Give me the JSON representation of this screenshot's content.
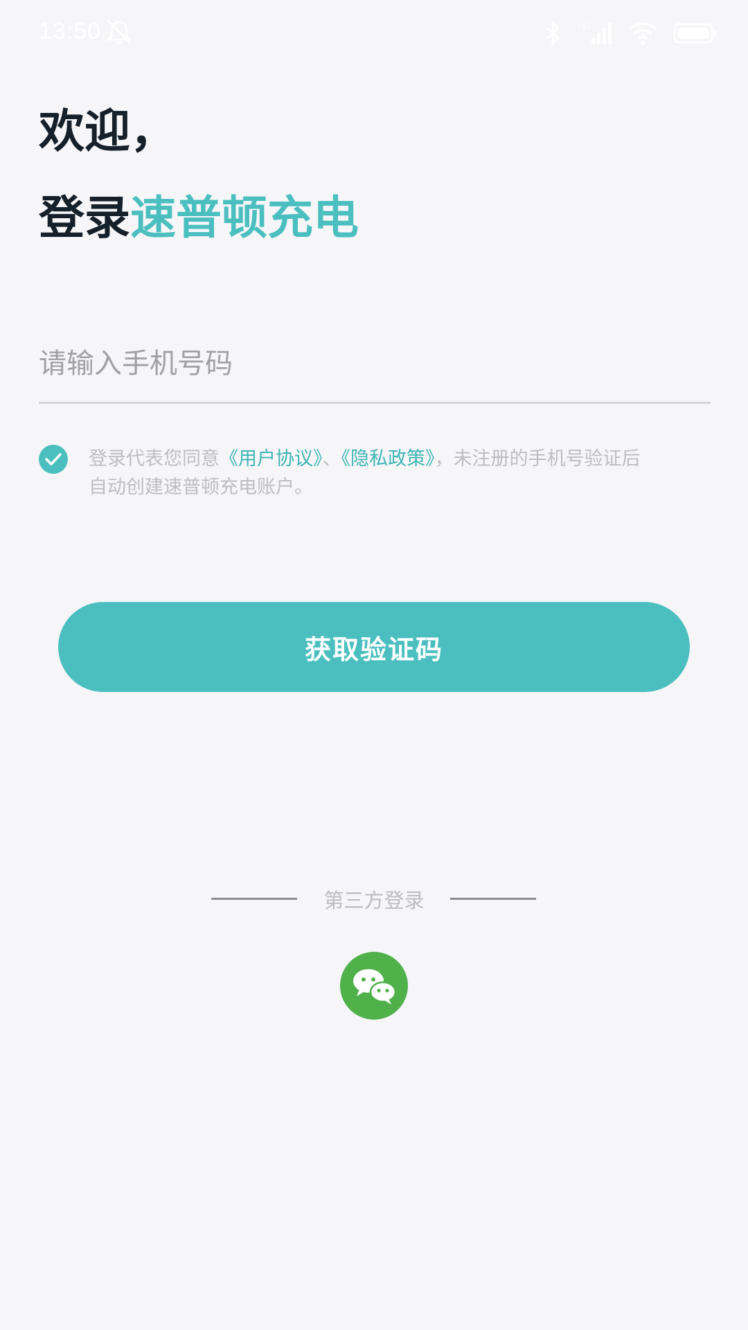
{
  "status_bar": {
    "time": "13:50",
    "mute_icon": "bell-off-icon",
    "bluetooth_icon": "bluetooth-icon",
    "signal_icon": "signal-icon",
    "wifi_icon": "wifi-icon",
    "battery_icon": "battery-icon"
  },
  "header": {
    "welcome": "欢迎，",
    "login_prefix": "登录",
    "brand_name": "速普顿充电"
  },
  "phone_input": {
    "placeholder": "请输入手机号码",
    "value": ""
  },
  "agreement": {
    "checked": true,
    "text_before": "登录代表您同意",
    "user_agreement": "《用户协议》",
    "separator": "、",
    "privacy_policy": "《隐私政策》",
    "text_after": "，未注册的手机号验证后",
    "line2": "自动创建速普顿充电账户。"
  },
  "primary_button": {
    "label": "获取验证码"
  },
  "third_party": {
    "label": "第三方登录",
    "wechat_icon": "wechat-icon"
  },
  "colors": {
    "accent": "#4bbfbf",
    "background": "#f6f6f9",
    "heading": "#15202b",
    "wechat": "#50b14b"
  }
}
